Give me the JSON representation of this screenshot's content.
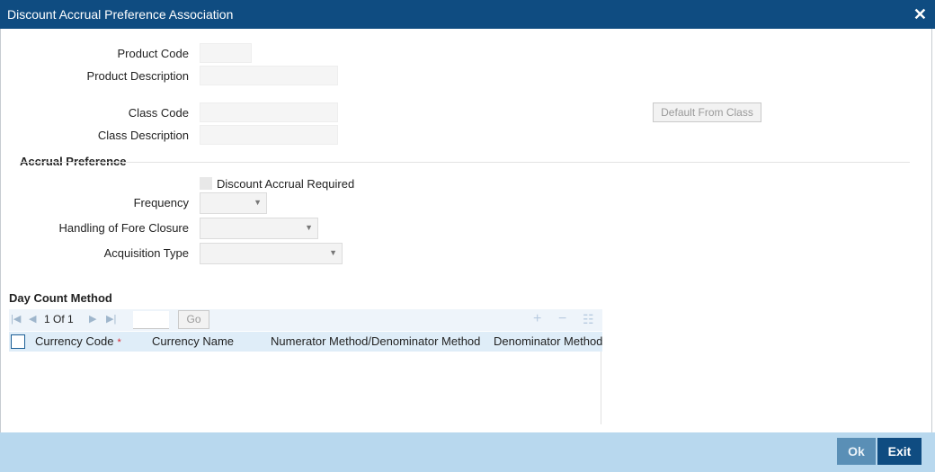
{
  "window": {
    "title": "Discount Accrual Preference Association",
    "close_glyph": "✕"
  },
  "product": {
    "code_label": "Product Code",
    "code_value": "",
    "description_label": "Product Description",
    "description_value": ""
  },
  "class": {
    "code_label": "Class Code",
    "code_value": "",
    "description_label": "Class Description",
    "description_value": "",
    "default_button": "Default From Class"
  },
  "accrual_preference": {
    "section_title": "Accrual Preference",
    "discount_accrual_required_label": "Discount Accrual Required",
    "discount_accrual_required_checked": false,
    "frequency_label": "Frequency",
    "frequency_value": "",
    "fore_closure_label": "Handling of Fore Closure",
    "fore_closure_value": "",
    "acquisition_type_label": "Acquisition Type",
    "acquisition_type_value": ""
  },
  "day_count": {
    "section_title": "Day Count Method",
    "pager": {
      "current": "1",
      "of_label": "Of",
      "total": "1",
      "go_label": "Go",
      "page_input": ""
    },
    "icons": {
      "first": "first-page-icon",
      "prev": "prev-page-icon",
      "next": "next-page-icon",
      "last": "last-page-icon",
      "add": "add-row-icon",
      "delete": "delete-row-icon",
      "columns": "column-settings-icon"
    },
    "columns": [
      "Currency Code",
      "Currency Name",
      "Numerator Method/Denominator Method",
      "Denominator Method"
    ],
    "required_marker": "*",
    "rows": []
  },
  "footer": {
    "ok_label": "Ok",
    "exit_label": "Exit"
  },
  "colors": {
    "title_bar": "#0f4c81",
    "footer": "#b8d8ee",
    "ok_button": "#5a8fb6",
    "exit_button": "#0f4c81",
    "grid_header": "#dfedf8",
    "required": "#d9262e"
  }
}
